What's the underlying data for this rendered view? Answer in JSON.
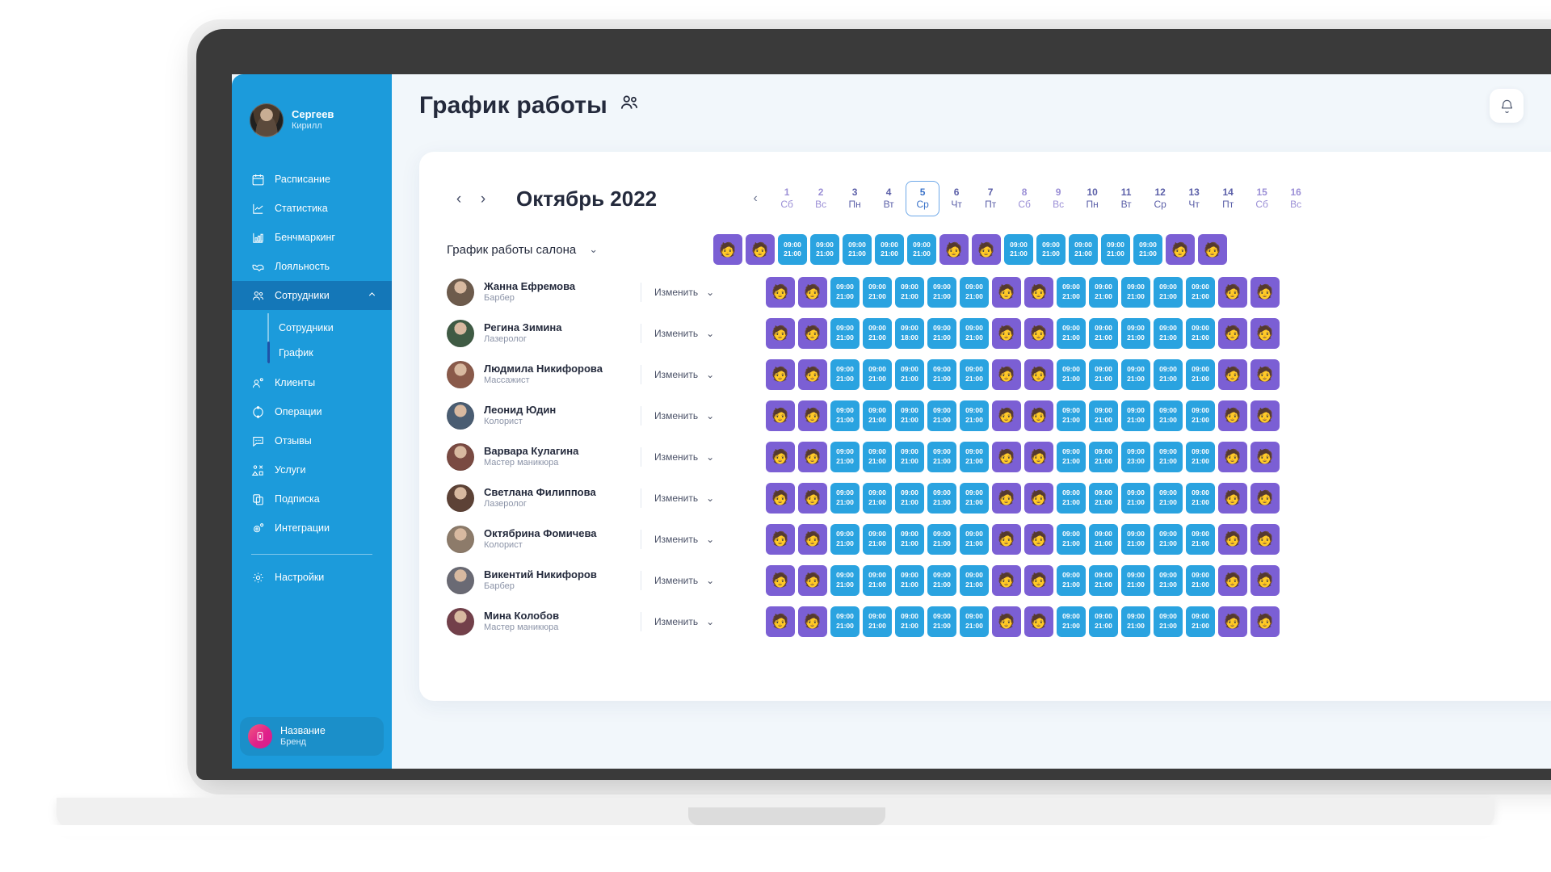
{
  "sidebar": {
    "profile": {
      "name": "Сергеев",
      "sub": "Кирилл"
    },
    "items": [
      {
        "label": "Расписание",
        "icon": "calendar-icon"
      },
      {
        "label": "Статистика",
        "icon": "line-chart-icon"
      },
      {
        "label": "Бенчмаркинг",
        "icon": "bar-chart-icon"
      },
      {
        "label": "Лояльность",
        "icon": "handshake-icon"
      },
      {
        "label": "Сотрудники",
        "icon": "people-icon"
      },
      {
        "label": "Клиенты",
        "icon": "person-add-icon"
      },
      {
        "label": "Операции",
        "icon": "refresh-icon"
      },
      {
        "label": "Отзывы",
        "icon": "chat-icon"
      },
      {
        "label": "Услуги",
        "icon": "shapes-icon"
      },
      {
        "label": "Подписка",
        "icon": "copy-icon"
      },
      {
        "label": "Интеграции",
        "icon": "gear-plus-icon"
      }
    ],
    "submenu": [
      {
        "label": "Сотрудники"
      },
      {
        "label": "График"
      }
    ],
    "settings": {
      "label": "Настройки",
      "icon": "gear-icon"
    },
    "brand": {
      "title": "Название",
      "sub": "Бренд"
    }
  },
  "header": {
    "title": "График работы",
    "icon": "people-icon"
  },
  "calendar": {
    "month": "Октябрь 2022",
    "prev_label": "‹",
    "next_label": "›",
    "strip_prev_label": "‹",
    "days": [
      {
        "num": "1",
        "dow": "Сб",
        "weekend": true,
        "selected": false
      },
      {
        "num": "2",
        "dow": "Вс",
        "weekend": true,
        "selected": false
      },
      {
        "num": "3",
        "dow": "Пн",
        "weekend": false,
        "selected": false
      },
      {
        "num": "4",
        "dow": "Вт",
        "weekend": false,
        "selected": false
      },
      {
        "num": "5",
        "dow": "Ср",
        "weekend": false,
        "selected": true
      },
      {
        "num": "6",
        "dow": "Чт",
        "weekend": false,
        "selected": false
      },
      {
        "num": "7",
        "dow": "Пт",
        "weekend": false,
        "selected": false
      },
      {
        "num": "8",
        "dow": "Сб",
        "weekend": true,
        "selected": false
      },
      {
        "num": "9",
        "dow": "Вс",
        "weekend": true,
        "selected": false
      },
      {
        "num": "10",
        "dow": "Пн",
        "weekend": false,
        "selected": false
      },
      {
        "num": "11",
        "dow": "Вт",
        "weekend": false,
        "selected": false
      },
      {
        "num": "12",
        "dow": "Ср",
        "weekend": false,
        "selected": false
      },
      {
        "num": "13",
        "dow": "Чт",
        "weekend": false,
        "selected": false
      },
      {
        "num": "14",
        "dow": "Пт",
        "weekend": false,
        "selected": false
      },
      {
        "num": "15",
        "dow": "Сб",
        "weekend": true,
        "selected": false
      },
      {
        "num": "16",
        "dow": "Вс",
        "weekend": true,
        "selected": false
      }
    ]
  },
  "salon_row": {
    "label": "График работы салона",
    "chevron": "⌄"
  },
  "edit_label": "Изменить",
  "edit_chevron": "⌄",
  "day_off_glyph": "🧑",
  "schedule": {
    "salon": [
      {
        "t": "off"
      },
      {
        "t": "off"
      },
      {
        "t": "work",
        "from": "09:00",
        "to": "21:00"
      },
      {
        "t": "work",
        "from": "09:00",
        "to": "21:00"
      },
      {
        "t": "work",
        "from": "09:00",
        "to": "21:00"
      },
      {
        "t": "work",
        "from": "09:00",
        "to": "21:00"
      },
      {
        "t": "work",
        "from": "09:00",
        "to": "21:00"
      },
      {
        "t": "off"
      },
      {
        "t": "off"
      },
      {
        "t": "work",
        "from": "09:00",
        "to": "21:00"
      },
      {
        "t": "work",
        "from": "09:00",
        "to": "21:00"
      },
      {
        "t": "work",
        "from": "09:00",
        "to": "21:00"
      },
      {
        "t": "work",
        "from": "09:00",
        "to": "21:00"
      },
      {
        "t": "work",
        "from": "09:00",
        "to": "21:00"
      },
      {
        "t": "off"
      },
      {
        "t": "off"
      }
    ],
    "employees": [
      {
        "name": "Жанна Ефремова",
        "role": "Барбер",
        "avatar": "#6d5b4c",
        "cells": [
          {
            "t": "off"
          },
          {
            "t": "off"
          },
          {
            "t": "work",
            "from": "09:00",
            "to": "21:00"
          },
          {
            "t": "work",
            "from": "09:00",
            "to": "21:00"
          },
          {
            "t": "work",
            "from": "09:00",
            "to": "21:00"
          },
          {
            "t": "work",
            "from": "09:00",
            "to": "21:00"
          },
          {
            "t": "work",
            "from": "09:00",
            "to": "21:00"
          },
          {
            "t": "off"
          },
          {
            "t": "off"
          },
          {
            "t": "work",
            "from": "09:00",
            "to": "21:00"
          },
          {
            "t": "work",
            "from": "09:00",
            "to": "21:00"
          },
          {
            "t": "work",
            "from": "09:00",
            "to": "21:00"
          },
          {
            "t": "work",
            "from": "09:00",
            "to": "21:00"
          },
          {
            "t": "work",
            "from": "09:00",
            "to": "21:00"
          },
          {
            "t": "off"
          },
          {
            "t": "off"
          }
        ]
      },
      {
        "name": "Регина Зимина",
        "role": "Лазеролог",
        "avatar": "#3f5b44",
        "cells": [
          {
            "t": "off"
          },
          {
            "t": "off"
          },
          {
            "t": "work",
            "from": "09:00",
            "to": "21:00"
          },
          {
            "t": "work",
            "from": "09:00",
            "to": "21:00"
          },
          {
            "t": "work",
            "from": "09:00",
            "to": "18:00"
          },
          {
            "t": "work",
            "from": "09:00",
            "to": "21:00"
          },
          {
            "t": "work",
            "from": "09:00",
            "to": "21:00"
          },
          {
            "t": "off"
          },
          {
            "t": "off"
          },
          {
            "t": "work",
            "from": "09:00",
            "to": "21:00"
          },
          {
            "t": "work",
            "from": "09:00",
            "to": "21:00"
          },
          {
            "t": "work",
            "from": "09:00",
            "to": "21:00"
          },
          {
            "t": "work",
            "from": "09:00",
            "to": "21:00"
          },
          {
            "t": "work",
            "from": "09:00",
            "to": "21:00"
          },
          {
            "t": "off"
          },
          {
            "t": "off"
          }
        ]
      },
      {
        "name": "Людмила Никифорова",
        "role": "Массажист",
        "avatar": "#8a5a4a",
        "cells": [
          {
            "t": "off"
          },
          {
            "t": "off"
          },
          {
            "t": "work",
            "from": "09:00",
            "to": "21:00"
          },
          {
            "t": "work",
            "from": "09:00",
            "to": "21:00"
          },
          {
            "t": "work",
            "from": "09:00",
            "to": "21:00"
          },
          {
            "t": "work",
            "from": "09:00",
            "to": "21:00"
          },
          {
            "t": "work",
            "from": "09:00",
            "to": "21:00"
          },
          {
            "t": "off"
          },
          {
            "t": "off"
          },
          {
            "t": "work",
            "from": "09:00",
            "to": "21:00"
          },
          {
            "t": "work",
            "from": "09:00",
            "to": "21:00"
          },
          {
            "t": "work",
            "from": "09:00",
            "to": "21:00"
          },
          {
            "t": "work",
            "from": "09:00",
            "to": "21:00"
          },
          {
            "t": "work",
            "from": "09:00",
            "to": "21:00"
          },
          {
            "t": "off"
          },
          {
            "t": "off"
          }
        ]
      },
      {
        "name": "Леонид Юдин",
        "role": "Колорист",
        "avatar": "#4a5d72",
        "cells": [
          {
            "t": "off"
          },
          {
            "t": "off"
          },
          {
            "t": "work",
            "from": "09:00",
            "to": "21:00"
          },
          {
            "t": "work",
            "from": "09:00",
            "to": "21:00"
          },
          {
            "t": "work",
            "from": "09:00",
            "to": "21:00"
          },
          {
            "t": "work",
            "from": "09:00",
            "to": "21:00"
          },
          {
            "t": "work",
            "from": "09:00",
            "to": "21:00"
          },
          {
            "t": "off"
          },
          {
            "t": "off"
          },
          {
            "t": "work",
            "from": "09:00",
            "to": "21:00"
          },
          {
            "t": "work",
            "from": "09:00",
            "to": "21:00"
          },
          {
            "t": "work",
            "from": "09:00",
            "to": "21:00"
          },
          {
            "t": "work",
            "from": "09:00",
            "to": "21:00"
          },
          {
            "t": "work",
            "from": "09:00",
            "to": "21:00"
          },
          {
            "t": "off"
          },
          {
            "t": "off"
          }
        ]
      },
      {
        "name": "Варвара Кулагина",
        "role": "Мастер маникюра",
        "avatar": "#7a4a42",
        "cells": [
          {
            "t": "off"
          },
          {
            "t": "off"
          },
          {
            "t": "work",
            "from": "09:00",
            "to": "21:00"
          },
          {
            "t": "work",
            "from": "09:00",
            "to": "21:00"
          },
          {
            "t": "work",
            "from": "09:00",
            "to": "21:00"
          },
          {
            "t": "work",
            "from": "09:00",
            "to": "21:00"
          },
          {
            "t": "work",
            "from": "09:00",
            "to": "21:00"
          },
          {
            "t": "off"
          },
          {
            "t": "off"
          },
          {
            "t": "work",
            "from": "09:00",
            "to": "21:00"
          },
          {
            "t": "work",
            "from": "09:00",
            "to": "21:00"
          },
          {
            "t": "work",
            "from": "09:00",
            "to": "23:00"
          },
          {
            "t": "work",
            "from": "09:00",
            "to": "21:00"
          },
          {
            "t": "work",
            "from": "09:00",
            "to": "21:00"
          },
          {
            "t": "off"
          },
          {
            "t": "off"
          }
        ]
      },
      {
        "name": "Светлана Филиппова",
        "role": "Лазеролог",
        "avatar": "#5d4236",
        "cells": [
          {
            "t": "off"
          },
          {
            "t": "off"
          },
          {
            "t": "work",
            "from": "09:00",
            "to": "21:00"
          },
          {
            "t": "work",
            "from": "09:00",
            "to": "21:00"
          },
          {
            "t": "work",
            "from": "09:00",
            "to": "21:00"
          },
          {
            "t": "work",
            "from": "09:00",
            "to": "21:00"
          },
          {
            "t": "work",
            "from": "09:00",
            "to": "21:00"
          },
          {
            "t": "off"
          },
          {
            "t": "off"
          },
          {
            "t": "work",
            "from": "09:00",
            "to": "21:00"
          },
          {
            "t": "work",
            "from": "09:00",
            "to": "21:00"
          },
          {
            "t": "work",
            "from": "09:00",
            "to": "21:00"
          },
          {
            "t": "work",
            "from": "09:00",
            "to": "21:00"
          },
          {
            "t": "work",
            "from": "09:00",
            "to": "21:00"
          },
          {
            "t": "off"
          },
          {
            "t": "off"
          }
        ]
      },
      {
        "name": "Октябрина Фомичева",
        "role": "Колорист",
        "avatar": "#8d7b6a",
        "cells": [
          {
            "t": "off"
          },
          {
            "t": "off"
          },
          {
            "t": "work",
            "from": "09:00",
            "to": "21:00"
          },
          {
            "t": "work",
            "from": "09:00",
            "to": "21:00"
          },
          {
            "t": "work",
            "from": "09:00",
            "to": "21:00"
          },
          {
            "t": "work",
            "from": "09:00",
            "to": "21:00"
          },
          {
            "t": "work",
            "from": "09:00",
            "to": "21:00"
          },
          {
            "t": "off"
          },
          {
            "t": "off"
          },
          {
            "t": "work",
            "from": "09:00",
            "to": "21:00"
          },
          {
            "t": "work",
            "from": "09:00",
            "to": "21:00"
          },
          {
            "t": "work",
            "from": "09:00",
            "to": "21:00"
          },
          {
            "t": "work",
            "from": "09:00",
            "to": "21:00"
          },
          {
            "t": "work",
            "from": "09:00",
            "to": "21:00"
          },
          {
            "t": "off"
          },
          {
            "t": "off"
          }
        ]
      },
      {
        "name": "Викентий Никифоров",
        "role": "Барбер",
        "avatar": "#6a6a74",
        "cells": [
          {
            "t": "off"
          },
          {
            "t": "off"
          },
          {
            "t": "work",
            "from": "09:00",
            "to": "21:00"
          },
          {
            "t": "work",
            "from": "09:00",
            "to": "21:00"
          },
          {
            "t": "work",
            "from": "09:00",
            "to": "21:00"
          },
          {
            "t": "work",
            "from": "09:00",
            "to": "21:00"
          },
          {
            "t": "work",
            "from": "09:00",
            "to": "21:00"
          },
          {
            "t": "off"
          },
          {
            "t": "off"
          },
          {
            "t": "work",
            "from": "09:00",
            "to": "21:00"
          },
          {
            "t": "work",
            "from": "09:00",
            "to": "21:00"
          },
          {
            "t": "work",
            "from": "09:00",
            "to": "21:00"
          },
          {
            "t": "work",
            "from": "09:00",
            "to": "21:00"
          },
          {
            "t": "work",
            "from": "09:00",
            "to": "21:00"
          },
          {
            "t": "off"
          },
          {
            "t": "off"
          }
        ]
      },
      {
        "name": "Мина Колобов",
        "role": "Мастер маникюра",
        "avatar": "#73404a",
        "cells": [
          {
            "t": "off"
          },
          {
            "t": "off"
          },
          {
            "t": "work",
            "from": "09:00",
            "to": "21:00"
          },
          {
            "t": "work",
            "from": "09:00",
            "to": "21:00"
          },
          {
            "t": "work",
            "from": "09:00",
            "to": "21:00"
          },
          {
            "t": "work",
            "from": "09:00",
            "to": "21:00"
          },
          {
            "t": "work",
            "from": "09:00",
            "to": "21:00"
          },
          {
            "t": "off"
          },
          {
            "t": "off"
          },
          {
            "t": "work",
            "from": "09:00",
            "to": "21:00"
          },
          {
            "t": "work",
            "from": "09:00",
            "to": "21:00"
          },
          {
            "t": "work",
            "from": "09:00",
            "to": "21:00"
          },
          {
            "t": "work",
            "from": "09:00",
            "to": "21:00"
          },
          {
            "t": "work",
            "from": "09:00",
            "to": "21:00"
          },
          {
            "t": "off"
          },
          {
            "t": "off"
          }
        ]
      }
    ]
  },
  "colors": {
    "sidebar": "#1c9bdb",
    "sidebar_active": "#1477b8",
    "work_cell": "#2aa3e0",
    "off_cell": "#7b5fd4",
    "brand_pink": "#e0218a",
    "selected_day": "#3b73c9"
  }
}
